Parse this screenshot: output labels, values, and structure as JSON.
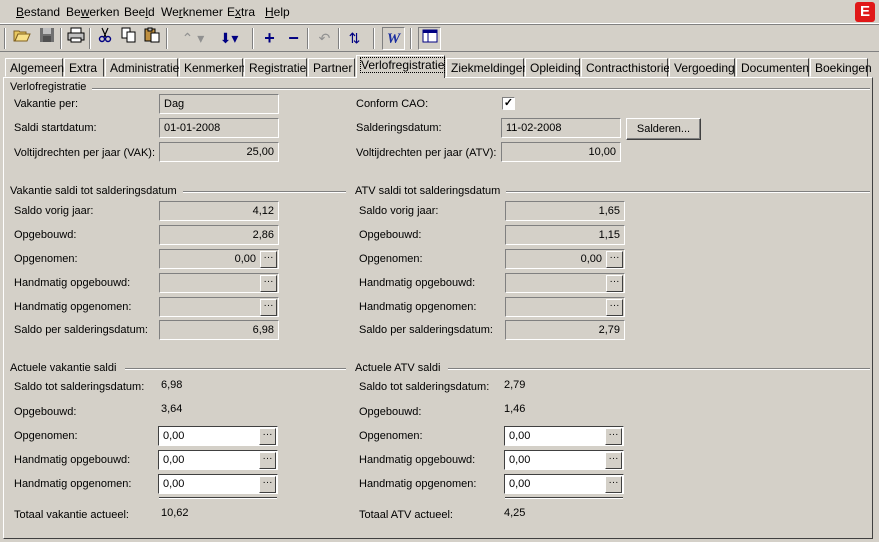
{
  "menu": {
    "items": [
      {
        "prefix": "",
        "accel": "B",
        "rest": "estand"
      },
      {
        "prefix": "Be",
        "accel": "w",
        "rest": "erken"
      },
      {
        "prefix": "Bee",
        "accel": "l",
        "rest": "d"
      },
      {
        "prefix": "We",
        "accel": "r",
        "rest": "knemer"
      },
      {
        "prefix": "E",
        "accel": "x",
        "rest": "tra"
      },
      {
        "prefix": "",
        "accel": "H",
        "rest": "elp"
      }
    ],
    "logo_letter": "E"
  },
  "toolbar": {
    "icons": [
      "open-folder-icon",
      "save-icon",
      "print-icon",
      "cut-icon",
      "copy-icon",
      "paste-icon",
      "up-arrow-icon",
      "down-arrow-icon",
      "add-icon",
      "remove-icon",
      "undo-icon",
      "refresh-icon",
      "word-icon",
      "window-icon"
    ]
  },
  "tabs": [
    "Algemeen",
    "Extra",
    "Administratie",
    "Kenmerken",
    "Registratie",
    "Partner",
    "Verlofregistratie",
    "Ziekmeldingen",
    "Opleiding",
    "Contracthistorie",
    "Vergoeding",
    "Documenten",
    "Boekingen"
  ],
  "active_tab": "Verlofregistratie",
  "verlof": {
    "title": "Verlofregistratie",
    "vakantie_per_label": "Vakantie per:",
    "vakantie_per_value": "Dag",
    "saldi_startdatum_label": "Saldi startdatum:",
    "saldi_startdatum_value": "01-01-2008",
    "voltijd_vak_label": "Voltijdrechten per jaar (VAK):",
    "voltijd_vak_value": "25,00",
    "conform_cao_label": "Conform CAO:",
    "conform_cao_checked": "✓",
    "salderingsdatum_label": "Salderingsdatum:",
    "salderingsdatum_value": "11-02-2008",
    "salderen_button": "Salderen...",
    "voltijd_atv_label": "Voltijdrechten per jaar (ATV):",
    "voltijd_atv_value": "10,00"
  },
  "vak_saldi": {
    "title": "Vakantie saldi tot salderingsdatum",
    "saldo_vorig_label": "Saldo vorig jaar:",
    "saldo_vorig_value": "4,12",
    "opgebouwd_label": "Opgebouwd:",
    "opgebouwd_value": "2,86",
    "opgenomen_label": "Opgenomen:",
    "opgenomen_value": "0,00",
    "handm_opgebouwd_label": "Handmatig opgebouwd:",
    "handm_opgebouwd_value": "",
    "handm_opgenomen_label": "Handmatig opgenomen:",
    "handm_opgenomen_value": "",
    "saldo_per_label": "Saldo per salderingsdatum:",
    "saldo_per_value": "6,98"
  },
  "atv_saldi": {
    "title": "ATV saldi tot salderingsdatum",
    "saldo_vorig_label": "Saldo vorig jaar:",
    "saldo_vorig_value": "1,65",
    "opgebouwd_label": "Opgebouwd:",
    "opgebouwd_value": "1,15",
    "opgenomen_label": "Opgenomen:",
    "opgenomen_value": "0,00",
    "handm_opgebouwd_label": "Handmatig opgebouwd:",
    "handm_opgebouwd_value": "",
    "handm_opgenomen_label": "Handmatig opgenomen:",
    "handm_opgenomen_value": "",
    "saldo_per_label": "Saldo per salderingsdatum:",
    "saldo_per_value": "2,79"
  },
  "act_vak": {
    "title": "Actuele vakantie saldi",
    "saldo_tot_label": "Saldo tot salderingsdatum:",
    "saldo_tot_value": "6,98",
    "opgebouwd_label": "Opgebouwd:",
    "opgebouwd_value": "3,64",
    "opgenomen_label": "Opgenomen:",
    "opgenomen_value": "0,00",
    "handm_opgebouwd_label": "Handmatig opgebouwd:",
    "handm_opgebouwd_value": "0,00",
    "handm_opgenomen_label": "Handmatig opgenomen:",
    "handm_opgenomen_value": "0,00",
    "totaal_label": "Totaal vakantie actueel:",
    "totaal_value": "10,62"
  },
  "act_atv": {
    "title": "Actuele ATV saldi",
    "saldo_tot_label": "Saldo tot salderingsdatum:",
    "saldo_tot_value": "2,79",
    "opgebouwd_label": "Opgebouwd:",
    "opgebouwd_value": "1,46",
    "opgenomen_label": "Opgenomen:",
    "opgenomen_value": "0,00",
    "handm_opgebouwd_label": "Handmatig opgebouwd:",
    "handm_opgebouwd_value": "0,00",
    "handm_opgenomen_label": "Handmatig opgenomen:",
    "handm_opgenomen_value": "0,00",
    "totaal_label": "Totaal ATV actueel:",
    "totaal_value": "4,25"
  },
  "dots_label": "···",
  "colors": {
    "window_bg": "#d4d0c8",
    "logo_red": "#e01818",
    "field_white": "#ffffff"
  }
}
